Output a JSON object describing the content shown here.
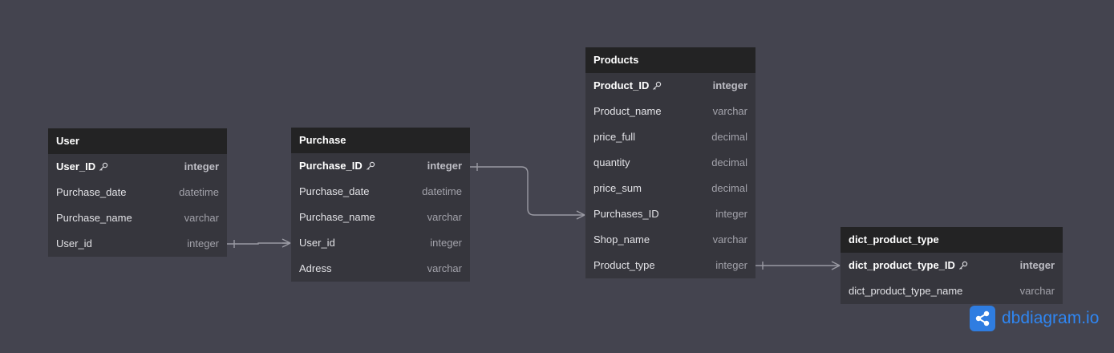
{
  "tables": {
    "user": {
      "title": "User",
      "rows": [
        {
          "name": "User_ID",
          "type": "integer"
        },
        {
          "name": "Purchase_date",
          "type": "datetime"
        },
        {
          "name": "Purchase_name",
          "type": "varchar"
        },
        {
          "name": "User_id",
          "type": "integer"
        }
      ]
    },
    "purchase": {
      "title": "Purchase",
      "rows": [
        {
          "name": "Purchase_ID",
          "type": "integer"
        },
        {
          "name": "Purchase_date",
          "type": "datetime"
        },
        {
          "name": "Purchase_name",
          "type": "varchar"
        },
        {
          "name": "User_id",
          "type": "integer"
        },
        {
          "name": "Adress",
          "type": "varchar"
        }
      ]
    },
    "products": {
      "title": "Products",
      "rows": [
        {
          "name": "Product_ID",
          "type": "integer"
        },
        {
          "name": "Product_name",
          "type": "varchar"
        },
        {
          "name": "price_full",
          "type": "decimal"
        },
        {
          "name": "quantity",
          "type": "decimal"
        },
        {
          "name": "price_sum",
          "type": "decimal"
        },
        {
          "name": "Purchases_ID",
          "type": "integer"
        },
        {
          "name": "Shop_name",
          "type": "varchar"
        },
        {
          "name": "Product_type",
          "type": "integer"
        }
      ]
    },
    "dict_product_type": {
      "title": "dict_product_type",
      "rows": [
        {
          "name": "dict_product_type_ID",
          "type": "integer"
        },
        {
          "name": "dict_product_type_name",
          "type": "varchar"
        }
      ]
    }
  },
  "brand": {
    "name": "dbdiagram.io"
  },
  "colors": {
    "background": "#44444f",
    "edge": "#9a9aa3",
    "brand": "#2f86f2"
  }
}
